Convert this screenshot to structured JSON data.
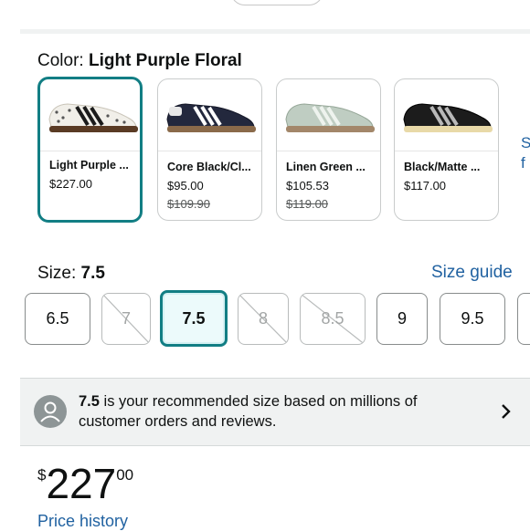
{
  "color": {
    "label": "Color:",
    "value": "Light Purple Floral"
  },
  "swatches": [
    {
      "name": "Light Purple ...",
      "price": "$227.00",
      "was": "",
      "selected": true
    },
    {
      "name": "Core Black/Cl...",
      "price": "$95.00",
      "was": "$109.90",
      "selected": false
    },
    {
      "name": "Linen Green ...",
      "price": "$105.53",
      "was": "$119.00",
      "selected": false
    },
    {
      "name": "Black/Matte ...",
      "price": "$117.00",
      "was": "",
      "selected": false
    }
  ],
  "peek_text": [
    "S",
    "f"
  ],
  "size": {
    "label": "Size:",
    "value": "7.5",
    "guide_link": "Size guide",
    "options": [
      {
        "label": "6.5",
        "available": true,
        "selected": false
      },
      {
        "label": "7",
        "available": false,
        "selected": false
      },
      {
        "label": "7.5",
        "available": true,
        "selected": true
      },
      {
        "label": "8",
        "available": false,
        "selected": false
      },
      {
        "label": "8.5",
        "available": false,
        "selected": false
      },
      {
        "label": "9",
        "available": true,
        "selected": false
      },
      {
        "label": "9.5",
        "available": true,
        "selected": false
      }
    ]
  },
  "recommendation": {
    "size": "7.5",
    "text": " is your recommended size based on millions of customer orders and reviews."
  },
  "price": {
    "symbol": "$",
    "whole": "227",
    "fraction": "00"
  },
  "price_history_link": "Price history",
  "colors": {
    "accent": "#127e84",
    "link": "#2162a1"
  }
}
